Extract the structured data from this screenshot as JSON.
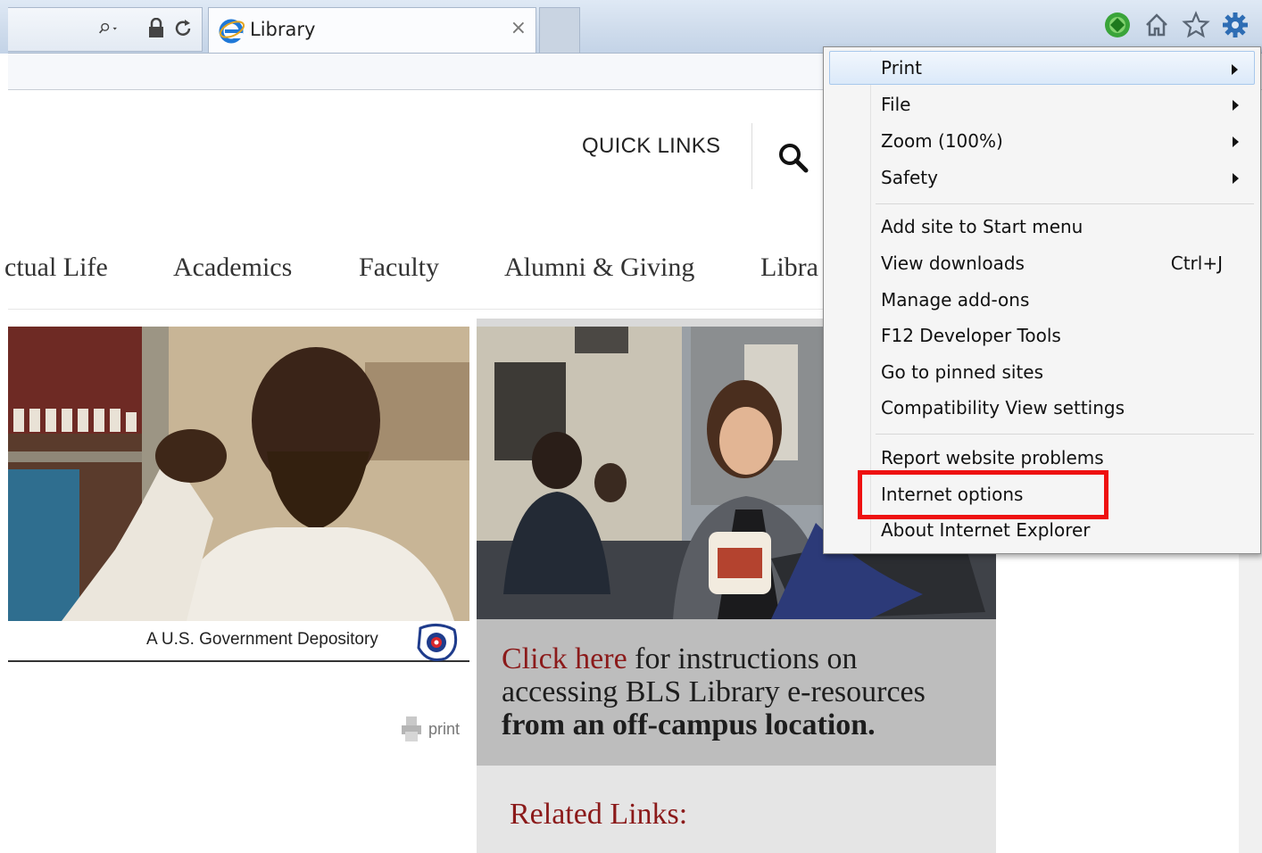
{
  "browser": {
    "tab_title": "Library",
    "tab_close": "×"
  },
  "page": {
    "quick_links": "QUICK LINKS",
    "nav": [
      "ctual Life",
      "Academics",
      "Faculty",
      "Alumni & Giving",
      "Libra"
    ],
    "caption": "A U.S. Government Depository",
    "print_label": "print",
    "promo": {
      "link": "Click here",
      "line1_rest": " for instructions on",
      "line2": "accessing BLS Library e-resources",
      "line3": "from an off-campus location."
    },
    "related_title": "Related Links:"
  },
  "menu": {
    "items": [
      {
        "label": "Print",
        "submenu": true
      },
      {
        "label": "File",
        "submenu": true
      },
      {
        "label": "Zoom (100%)",
        "submenu": true
      },
      {
        "label": "Safety",
        "submenu": true
      },
      {
        "label": "Add site to Start menu"
      },
      {
        "label": "View downloads",
        "shortcut": "Ctrl+J"
      },
      {
        "label": "Manage add-ons"
      },
      {
        "label": "F12 Developer Tools"
      },
      {
        "label": "Go to pinned sites"
      },
      {
        "label": "Compatibility View settings"
      },
      {
        "label": "Report website problems"
      },
      {
        "label": "Internet options"
      },
      {
        "label": "About Internet Explorer"
      }
    ]
  },
  "colors": {
    "accent_red": "#8b1a1a",
    "highlight_red": "#ee1111",
    "menu_hover": "#dbe9f9"
  }
}
